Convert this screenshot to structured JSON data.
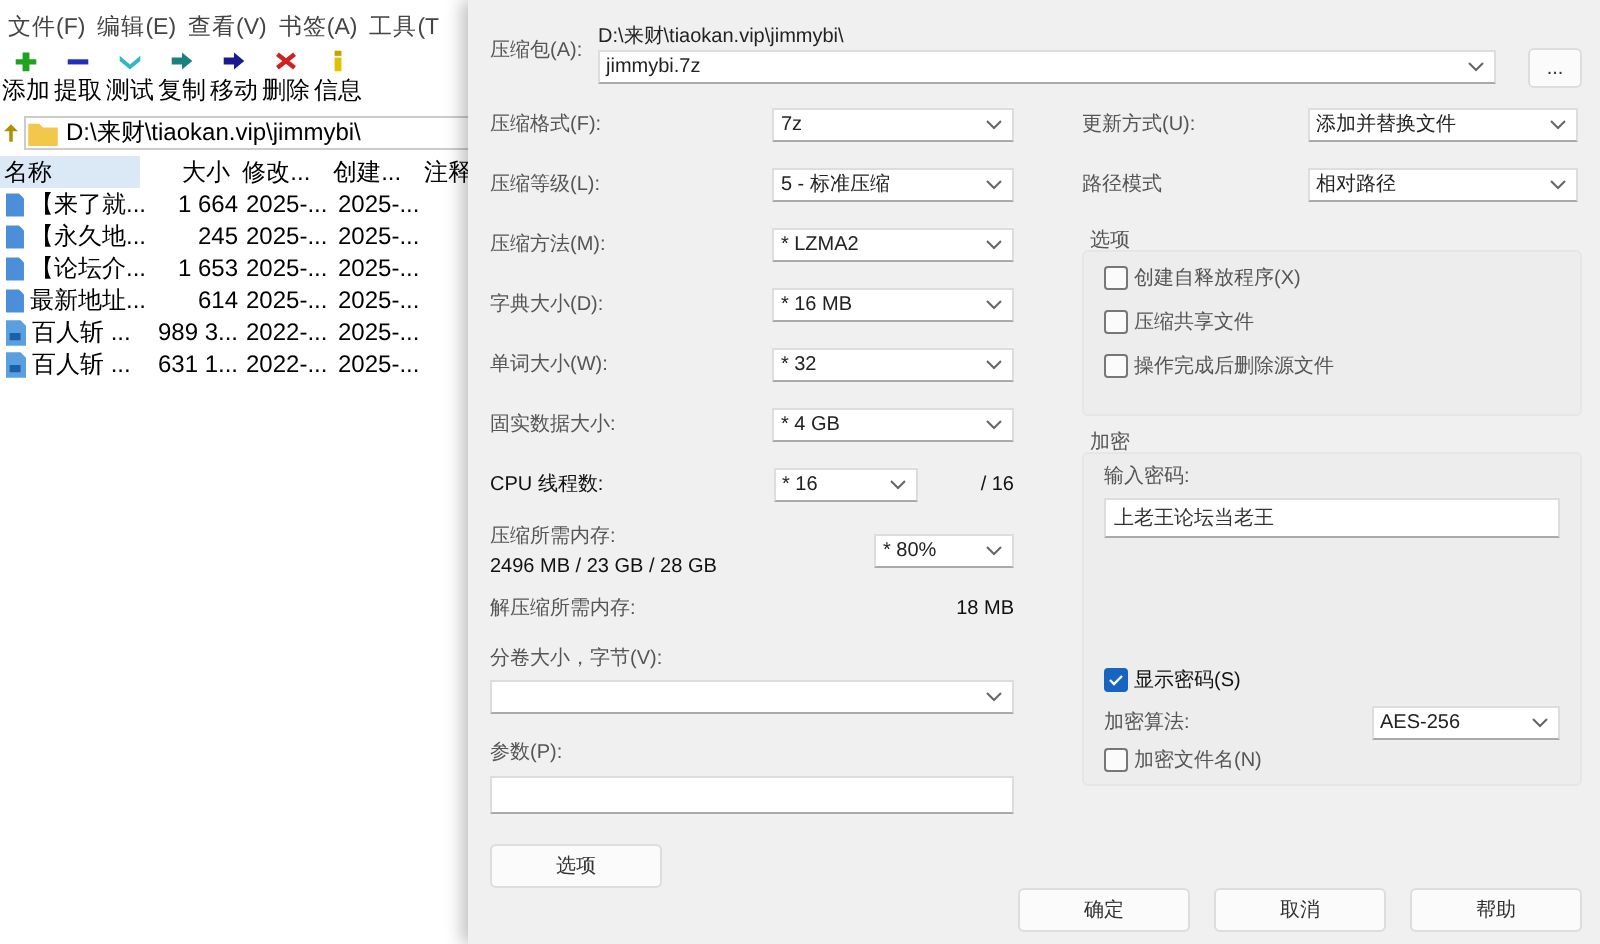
{
  "file_manager": {
    "menu": [
      "文件(F)",
      "编辑(E)",
      "查看(V)",
      "书签(A)",
      "工具(T"
    ],
    "toolbar": [
      {
        "label": "添加",
        "kind": "add"
      },
      {
        "label": "提取",
        "kind": "extract"
      },
      {
        "label": "测试",
        "kind": "test"
      },
      {
        "label": "复制",
        "kind": "copy"
      },
      {
        "label": "移动",
        "kind": "move"
      },
      {
        "label": "删除",
        "kind": "delete"
      },
      {
        "label": "信息",
        "kind": "info"
      }
    ],
    "path": "D:\\来财\\tiaokan.vip\\jimmybi\\",
    "columns": [
      {
        "label": "名称",
        "sorted": true
      },
      {
        "label": "大小",
        "sorted": false
      },
      {
        "label": "修改...",
        "sorted": false
      },
      {
        "label": "创建...",
        "sorted": false
      },
      {
        "label": "注释",
        "sorted": false
      }
    ],
    "rows": [
      {
        "kind": "document",
        "name": "【来了就...",
        "size": "1 664",
        "modified": "2025-...",
        "created": "2025-..."
      },
      {
        "kind": "document",
        "name": "【永久地...",
        "size": "245",
        "modified": "2025-...",
        "created": "2025-..."
      },
      {
        "kind": "document",
        "name": "【论坛介...",
        "size": "1 653",
        "modified": "2025-...",
        "created": "2025-..."
      },
      {
        "kind": "document",
        "name": "最新地址...",
        "size": "614",
        "modified": "2025-...",
        "created": "2025-..."
      },
      {
        "kind": "archive",
        "name": "百人斩 ...",
        "size": "989 3...",
        "modified": "2022-...",
        "created": "2025-..."
      },
      {
        "kind": "archive",
        "name": "百人斩 ...",
        "size": "631 1...",
        "modified": "2022-...",
        "created": "2025-..."
      }
    ]
  },
  "dialog": {
    "archive": {
      "label": "压缩包(A):",
      "folder": "D:\\来财\\tiaokan.vip\\jimmybi\\",
      "filename": "jimmybi.7z",
      "browse": "..."
    },
    "settings": [
      {
        "label": "压缩格式(F):",
        "value": "7z"
      },
      {
        "label": "压缩等级(L):",
        "value": "5 - 标准压缩"
      },
      {
        "label": "压缩方法(M):",
        "value": "*  LZMA2"
      },
      {
        "label": "字典大小(D):",
        "value": "*  16 MB"
      },
      {
        "label": "单词大小(W):",
        "value": "*  32"
      },
      {
        "label": "固实数据大小:",
        "value": "*  4 GB"
      }
    ],
    "cpu": {
      "label": "CPU 线程数:",
      "value": "*  16",
      "max": "/ 16"
    },
    "memory": {
      "label": "压缩所需内存:",
      "value": "2496 MB / 23 GB / 28 GB",
      "limit": "* 80%"
    },
    "decompress_memory": {
      "label": "解压缩所需内存:",
      "value": "18 MB"
    },
    "volume": {
      "label": "分卷大小，字节(V):"
    },
    "parameters": {
      "label": "参数(P):"
    },
    "options_button": "选项",
    "update": {
      "label": "更新方式(U):",
      "value": "添加并替换文件"
    },
    "path_mode": {
      "label": "路径模式",
      "value": "相对路径"
    },
    "options": {
      "title": "选项",
      "checkboxes": [
        {
          "label": "创建自释放程序(X)",
          "checked": false
        },
        {
          "label": "压缩共享文件",
          "checked": false
        },
        {
          "label": "操作完成后删除源文件",
          "checked": false
        }
      ]
    },
    "encryption": {
      "title": "加密",
      "password_label": "输入密码:",
      "password": "上老王论坛当老王",
      "show_password": {
        "label": "显示密码(S)",
        "checked": true
      },
      "algorithm": {
        "label": "加密算法:",
        "value": "AES-256"
      },
      "encrypt_names": {
        "label": "加密文件名(N)",
        "checked": false
      }
    },
    "buttons": [
      "确定",
      "取消",
      "帮助"
    ]
  }
}
